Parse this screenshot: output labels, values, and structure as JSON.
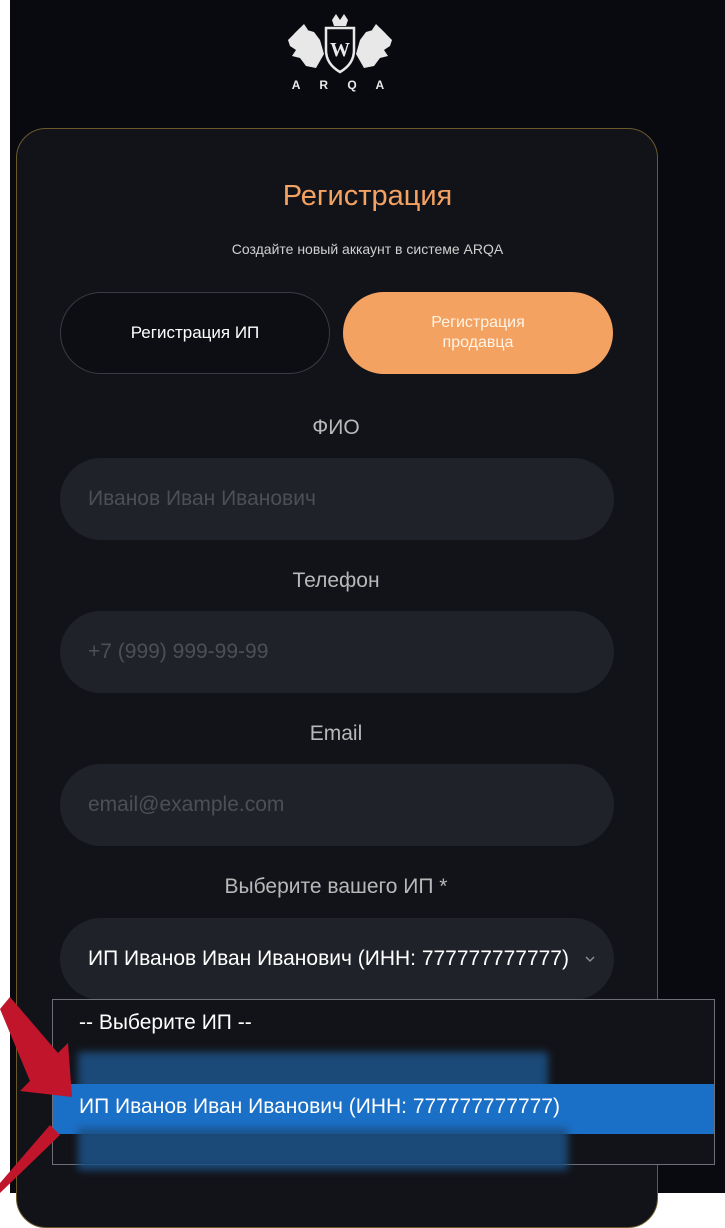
{
  "logo": {
    "text": "A R Q A"
  },
  "card": {
    "title": "Регистрация",
    "subtitle": "Создайте новый аккаунт в системе ARQA"
  },
  "tabs": [
    {
      "label": "Регистрация ИП",
      "active": false
    },
    {
      "label": "Регистрация продавца",
      "active": true
    }
  ],
  "form": {
    "fio": {
      "label": "ФИО",
      "placeholder": "Иванов Иван Иванович"
    },
    "phone": {
      "label": "Телефон",
      "placeholder": "+7 (999) 999-99-99"
    },
    "email": {
      "label": "Email",
      "placeholder": "email@example.com"
    },
    "ip_select": {
      "label": "Выберите вашего ИП *",
      "value": "ИП Иванов Иван Иванович (ИНН: 777777777777)",
      "options": [
        "-- Выберите ИП --",
        "ИП Иванов Иван Иванович (ИНН: 777777777777)"
      ]
    }
  },
  "colors": {
    "accent": "#f4a261",
    "highlight": "#1a6fc7",
    "annotation_arrow": "#c0152a",
    "background": "#080a10",
    "card": "#121319",
    "field": "#202229"
  }
}
